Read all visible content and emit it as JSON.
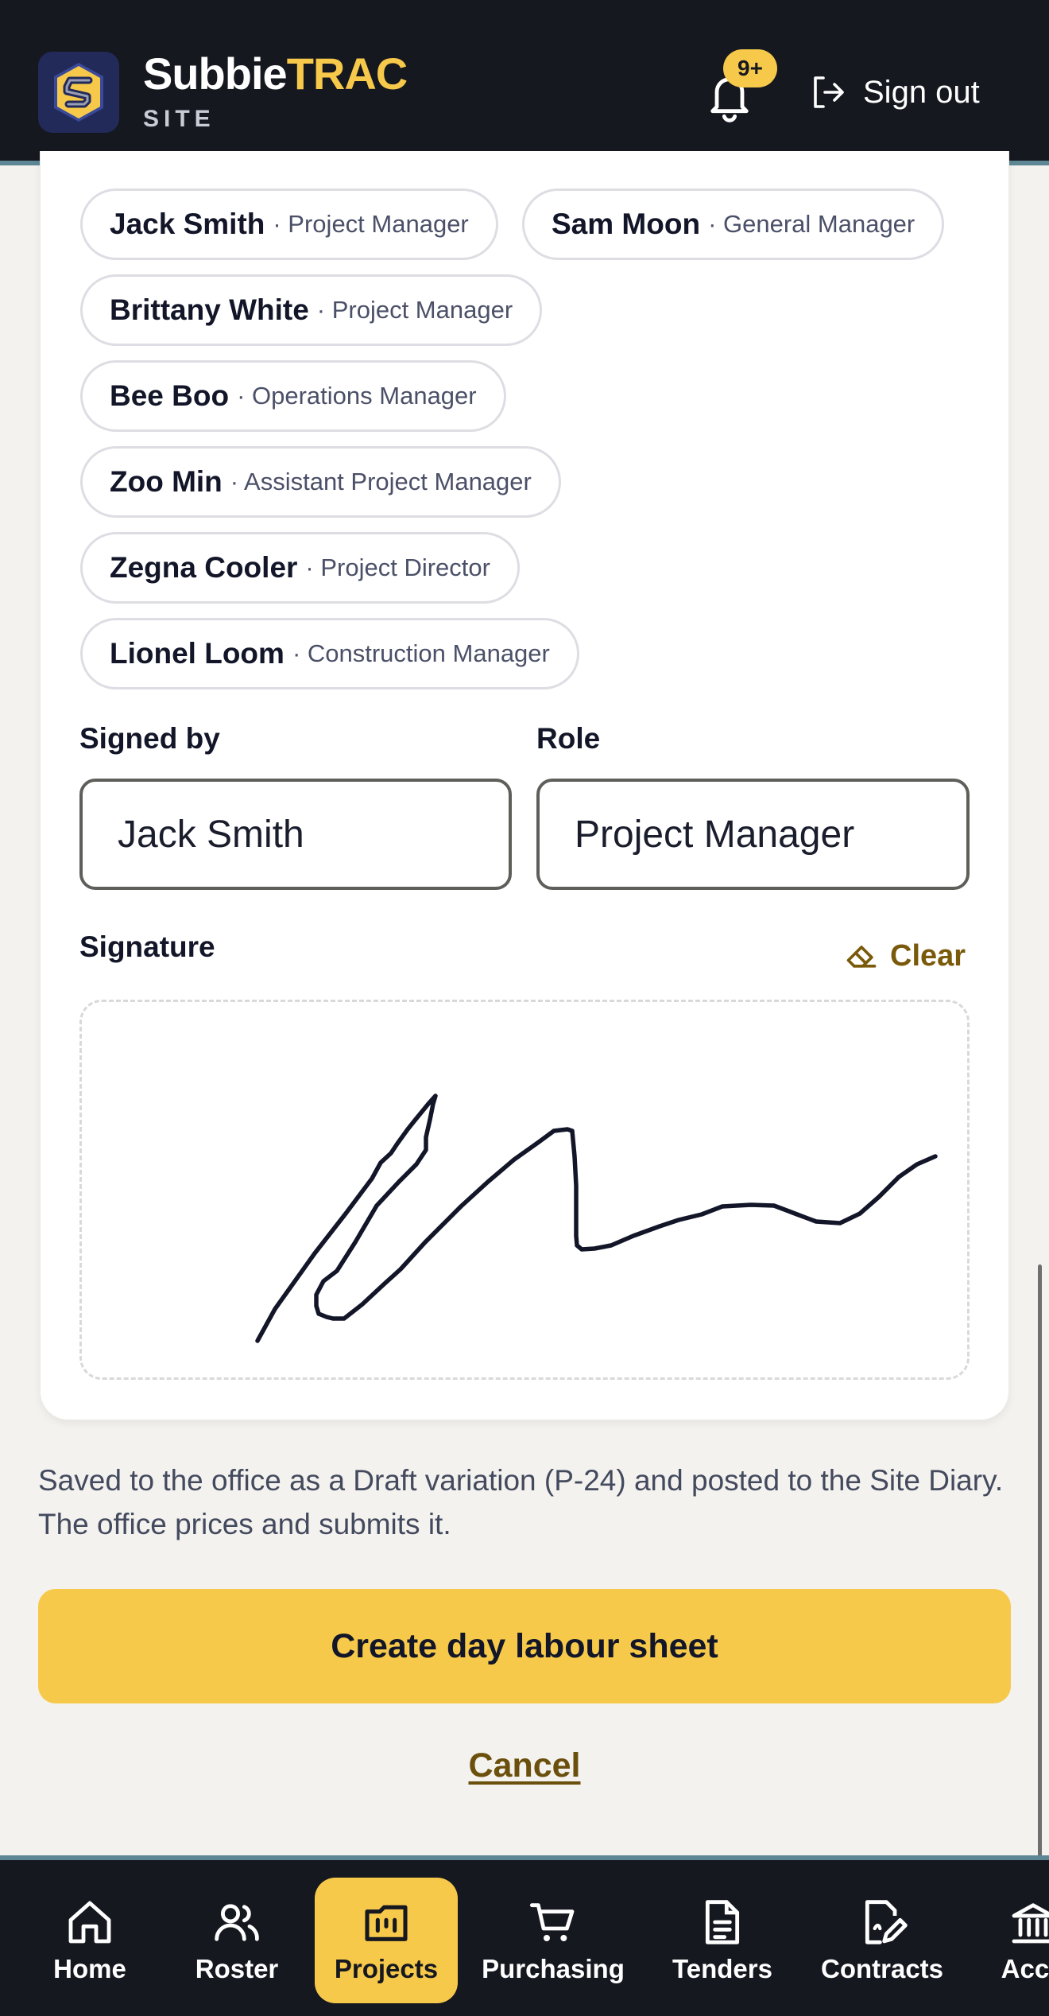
{
  "header": {
    "brand_name": "Subbie",
    "brand_accent": "TRAC",
    "brand_sub": "SITE",
    "notification_count": "9+",
    "signout_label": "Sign out"
  },
  "people": [
    {
      "name": "Jack Smith",
      "role": "· Project Manager"
    },
    {
      "name": "Sam Moon",
      "role": "· General Manager"
    },
    {
      "name": "Brittany White",
      "role": "· Project Manager"
    },
    {
      "name": "Bee Boo",
      "role": "· Operations Manager"
    },
    {
      "name": "Zoo Min",
      "role": "· Assistant Project Manager"
    },
    {
      "name": "Zegna Cooler",
      "role": "· Project Director"
    },
    {
      "name": "Lionel Loom",
      "role": "· Construction Manager"
    }
  ],
  "form": {
    "signed_by_label": "Signed by",
    "signed_by_value": "Jack Smith",
    "role_label": "Role",
    "role_value": "Project Manager",
    "signature_label": "Signature",
    "clear_label": "Clear"
  },
  "helper_text": "Saved to the office as a Draft variation (P-24) and posted to the Site Diary. The office prices and submits it.",
  "actions": {
    "primary_label": "Create day labour sheet",
    "cancel_label": "Cancel"
  },
  "nav": {
    "items": [
      {
        "label": "Home",
        "icon": "home-icon"
      },
      {
        "label": "Roster",
        "icon": "users-icon"
      },
      {
        "label": "Projects",
        "icon": "projects-icon",
        "active": true
      },
      {
        "label": "Purchasing",
        "icon": "cart-icon"
      },
      {
        "label": "Tenders",
        "icon": "document-icon"
      },
      {
        "label": "Contracts",
        "icon": "contract-icon"
      },
      {
        "label": "Acco",
        "icon": "bank-icon"
      }
    ]
  },
  "colors": {
    "header_bg": "#161820",
    "accent": "#f7c94a",
    "divider": "#5d8795",
    "page_bg": "#f3f2ee"
  }
}
